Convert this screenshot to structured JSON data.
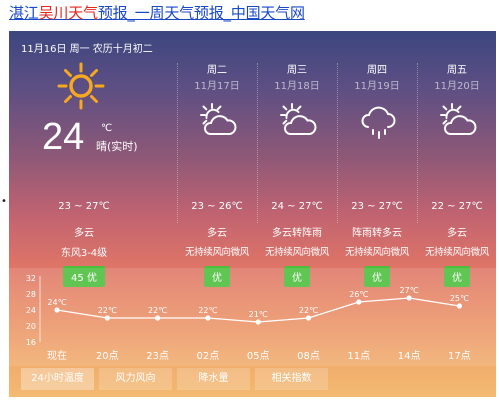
{
  "page": {
    "title_prefix": "湛江",
    "title_highlight": "吴川天气",
    "title_rest": "预报_一周天气预报_中国天气网",
    "bullet": "•"
  },
  "colors": {
    "title_link": "#1a49c8",
    "title_highlight": "#e3271d",
    "aqi_badge": "#4cbe3c",
    "sun_icon": "#f8a81f",
    "chart_line": "#ffffff"
  },
  "header": {
    "date_line": "11月16日 周一 农历十月初二"
  },
  "today": {
    "icon": "sun-icon",
    "temp": "24",
    "unit": "℃",
    "realtime": "晴(实时)",
    "range": "23 ~ 27℃",
    "condition": "多云",
    "wind": "东风3-4级",
    "aqi": "45 优"
  },
  "forecast": [
    {
      "name": "周二",
      "date": "11月17日",
      "icon": "partly-cloudy-icon",
      "range": "23 ~ 26℃",
      "condition": "多云",
      "wind": "无持续风向微风",
      "aqi": "优"
    },
    {
      "name": "周三",
      "date": "11月18日",
      "icon": "partly-cloudy-icon",
      "range": "24 ~ 27℃",
      "condition": "多云转阵雨",
      "wind": "无持续风向微风",
      "aqi": "优"
    },
    {
      "name": "周四",
      "date": "11月19日",
      "icon": "rain-cloud-icon",
      "range": "23 ~ 27℃",
      "condition": "阵雨转多云",
      "wind": "无持续风向微风",
      "aqi": "优"
    },
    {
      "name": "周五",
      "date": "11月20日",
      "icon": "partly-cloudy-icon",
      "range": "22 ~ 27℃",
      "condition": "多云",
      "wind": "无持续风向微风",
      "aqi": "优"
    }
  ],
  "chart_data": {
    "type": "line",
    "categories": [
      "现在",
      "20点",
      "23点",
      "02点",
      "05点",
      "08点",
      "11点",
      "14点",
      "17点"
    ],
    "values": [
      24,
      22,
      22,
      22,
      21,
      22,
      26,
      27,
      25
    ],
    "data_labels": [
      "24℃",
      "22℃",
      "22℃",
      "22℃",
      "21℃",
      "22℃",
      "26℃",
      "27℃",
      "25℃"
    ],
    "y_ticks": [
      "32",
      "28",
      "24",
      "20",
      "16"
    ],
    "ylim": [
      16,
      32
    ],
    "grid": false,
    "legend": "none"
  },
  "tabs": [
    "24小时温度",
    "风力风向",
    "降水量",
    "相关指数"
  ]
}
